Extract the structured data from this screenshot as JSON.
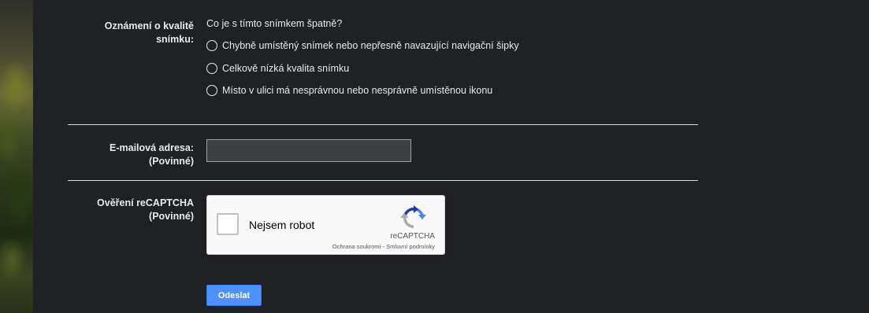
{
  "quality_report": {
    "label_line1": "Oznámení o kvalitě",
    "label_line2": "snímku:",
    "question": "Co je s tímto snímkem špatně?",
    "options": [
      {
        "label": "Chybně umístěný snímek nebo nepřesně navazující navigační šipky",
        "selected": false
      },
      {
        "label": "Celkově nízká kvalita snímku",
        "selected": false
      },
      {
        "label": "Místo v ulici má nesprávnou nebo nesprávně umístěnou ikonu",
        "selected": false
      }
    ]
  },
  "email": {
    "label_line1": "E-mailová adresa:",
    "label_line2": "(Povinné)",
    "value": ""
  },
  "recaptcha": {
    "label_line1": "Ověření reCAPTCHA",
    "label_line2": "(Povinné)",
    "checkbox_label": "Nejsem robot",
    "brand": "reCAPTCHA",
    "privacy_link": "Ochrana soukromí",
    "separator": " - ",
    "terms_link": "Smluvní podmínky",
    "checked": false
  },
  "submit": {
    "label": "Odeslat"
  },
  "colors": {
    "background": "#202124",
    "text": "#e8eaed",
    "divider": "#dadce0",
    "submit": "#4d90fe",
    "recaptcha_blue": "#1c3aa9",
    "recaptcha_light_blue": "#4285f4",
    "recaptcha_gray": "#ababab"
  }
}
